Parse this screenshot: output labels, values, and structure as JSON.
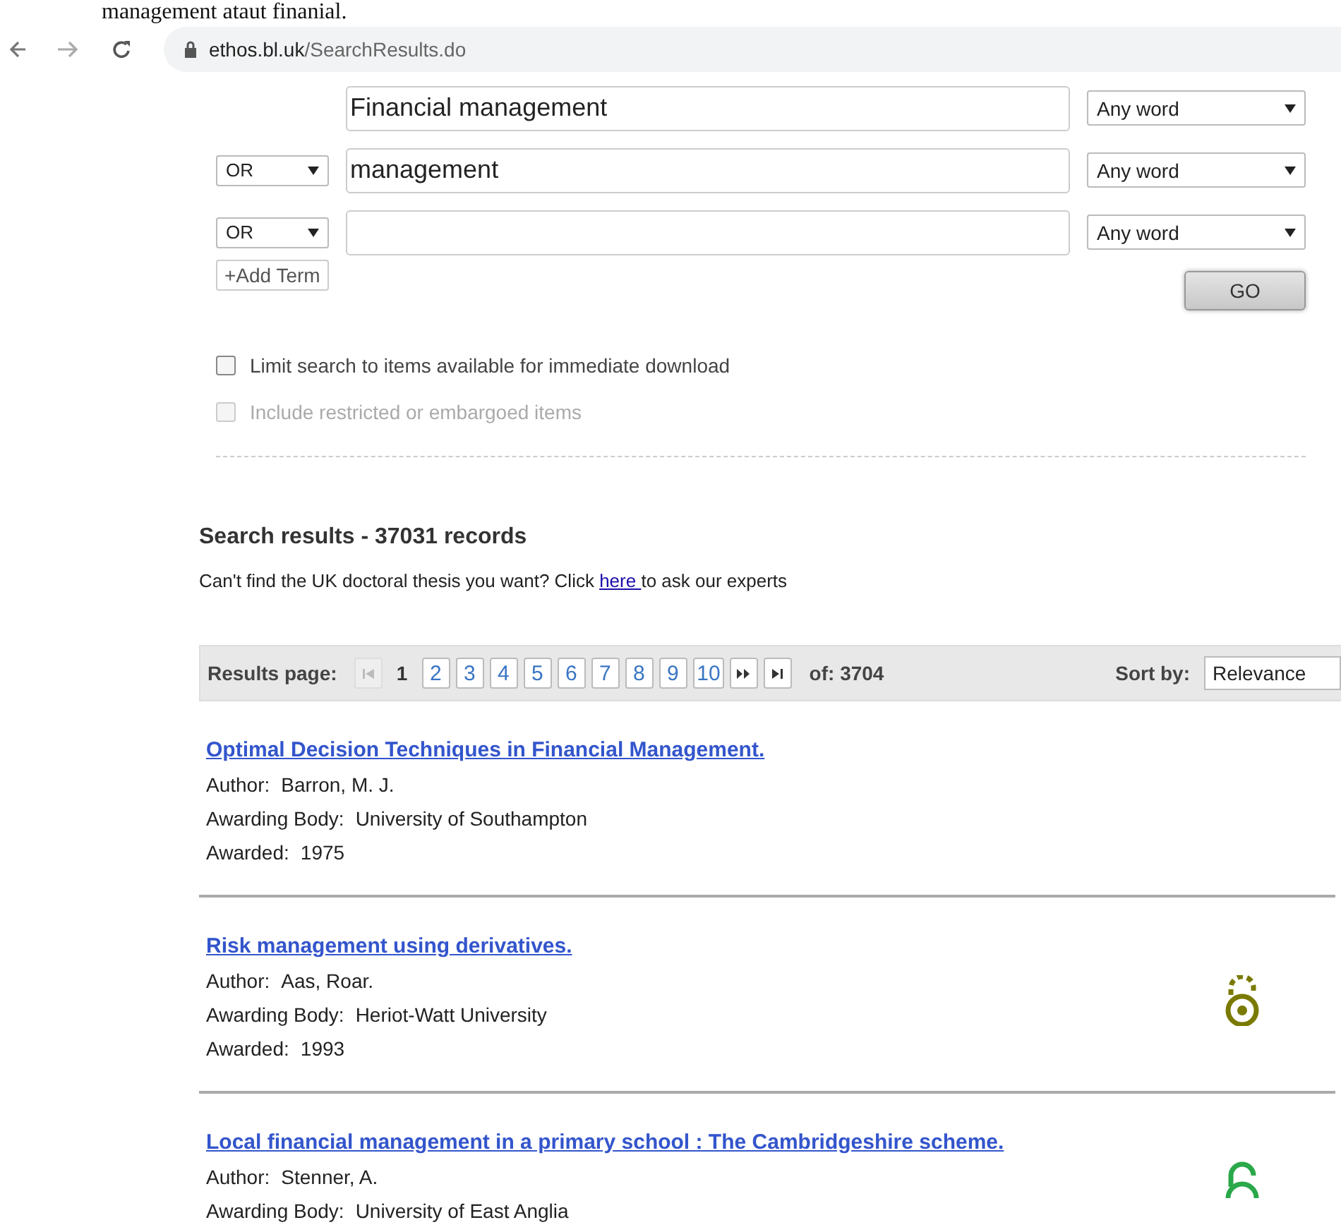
{
  "page_text": "management ataut finanial.",
  "browser": {
    "url_host": "ethos.bl.uk",
    "url_path": "/SearchResults.do"
  },
  "search_terms": [
    {
      "value": "Financial management",
      "match": "Any word"
    },
    {
      "operator": "OR",
      "value": "management",
      "match": "Any word"
    },
    {
      "operator": "OR",
      "match": "Any word"
    }
  ],
  "add_term": "+Add Term",
  "go": "GO",
  "options": [
    {
      "label": "Limit search to items available for immediate download",
      "checked": false,
      "disabled": false
    },
    {
      "label": "Include restricted or embargoed items",
      "checked": false,
      "disabled": true
    }
  ],
  "results_heading": "Search results - 37031 records",
  "help": {
    "before": "Can't find the UK doctoral thesis you want? Click ",
    "link": "here ",
    "after": "to ask our experts"
  },
  "pager": {
    "label": "Results page:",
    "pages": [
      {
        "label": "1",
        "selected": true
      },
      {
        "label": "2",
        "selected": false
      },
      {
        "label": "3",
        "selected": false
      },
      {
        "label": "4",
        "selected": false
      },
      {
        "label": "5",
        "selected": false
      },
      {
        "label": "6",
        "selected": false
      },
      {
        "label": "7",
        "selected": false
      },
      {
        "label": "8",
        "selected": false
      },
      {
        "label": "9",
        "selected": false
      },
      {
        "label": "10",
        "selected": false
      }
    ],
    "total": "of: 3704",
    "sort_label": "Sort by:",
    "sort_value": "Relevance"
  },
  "results": [
    {
      "title": "Optimal Decision Techniques in Financial Management.",
      "kind": "plain",
      "fields": [
        {
          "label": "Author:",
          "value": "Barron, M. J."
        },
        {
          "label": "Awarding Body:",
          "value": "University of Southampton"
        },
        {
          "label": "Awarded:",
          "value": "1975"
        }
      ]
    },
    {
      "title": "Risk management using derivatives.",
      "kind": "restricted",
      "fields": [
        {
          "label": "Author:",
          "value": "Aas, Roar."
        },
        {
          "label": "Awarding Body:",
          "value": "Heriot-Watt University"
        },
        {
          "label": "Awarded:",
          "value": "1993"
        }
      ]
    },
    {
      "title": "Local financial management in a primary school : The Cambridgeshire scheme.",
      "kind": "open",
      "fields": [
        {
          "label": "Author:",
          "value": "Stenner, A."
        },
        {
          "label": "Awarding Body:",
          "value": "University of East Anglia"
        }
      ]
    }
  ]
}
